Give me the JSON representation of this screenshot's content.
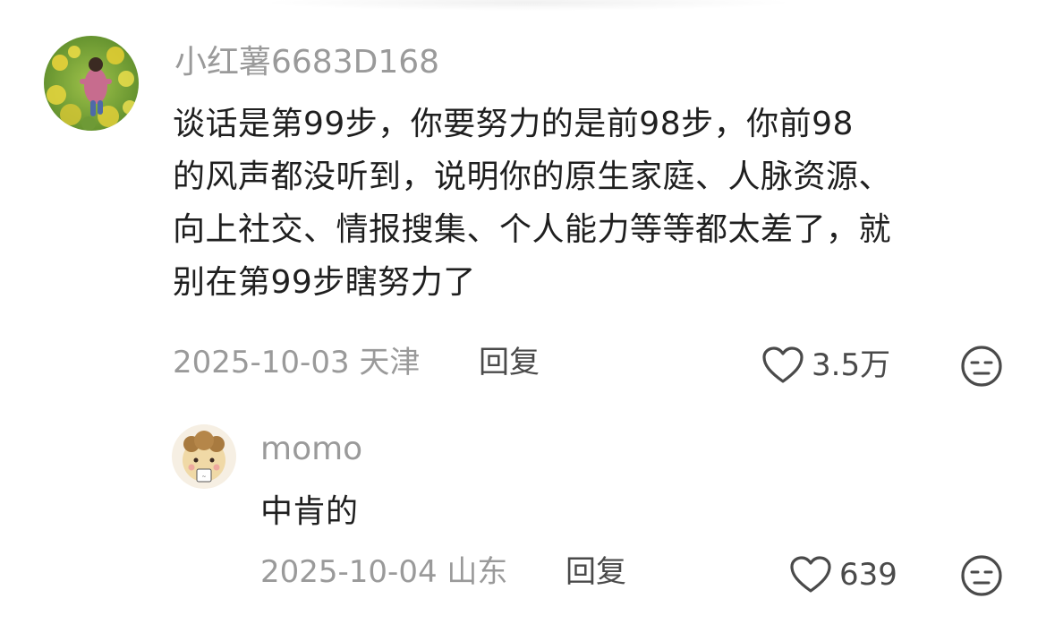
{
  "comments": [
    {
      "username": "小红薯6683D168",
      "lines": [
        "谈话是第99步，你要努力的是前98步，你前98",
        "的风声都没听到，说明你的原生家庭、人脉资源、",
        "向上社交、情报搜集、个人能力等等都太差了，就",
        "别在第99步瞎努力了"
      ],
      "date": "2025-10-03",
      "location": "天津",
      "reply_label": "回复",
      "likes": "3.5万",
      "avatar_icon": "photo-avatar-flowers",
      "dislike_icon": "meh-face-icon"
    },
    {
      "username": "momo",
      "text": "中肯的",
      "date": "2025-10-04",
      "location": "山东",
      "reply_label": "回复",
      "likes": "639",
      "avatar_icon": "cartoon-avatar",
      "dislike_icon": "meh-face-icon"
    }
  ],
  "colors": {
    "username": "#9a9a9a",
    "body": "#1f1f1f",
    "meta": "#9a9a9a",
    "icon": "#4a4a4a"
  }
}
